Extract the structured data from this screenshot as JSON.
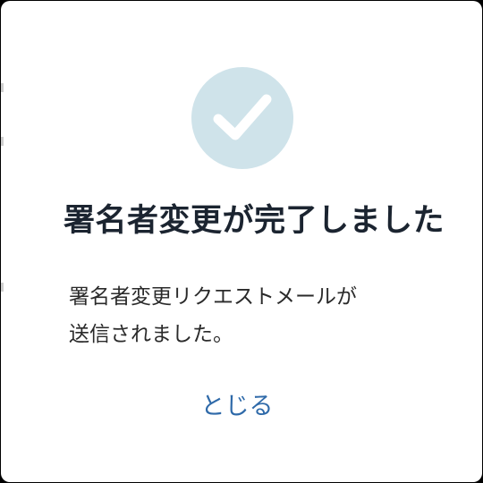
{
  "dialog": {
    "title": "署名者変更が完了しました",
    "message_line1": "署名者変更リクエストメールが",
    "message_line2": "送信されました。",
    "close_label": "とじる",
    "icon": "check-icon"
  },
  "colors": {
    "icon_circle": "#cfe3ea",
    "title_text": "#1b2430",
    "link": "#2f6aa9"
  }
}
